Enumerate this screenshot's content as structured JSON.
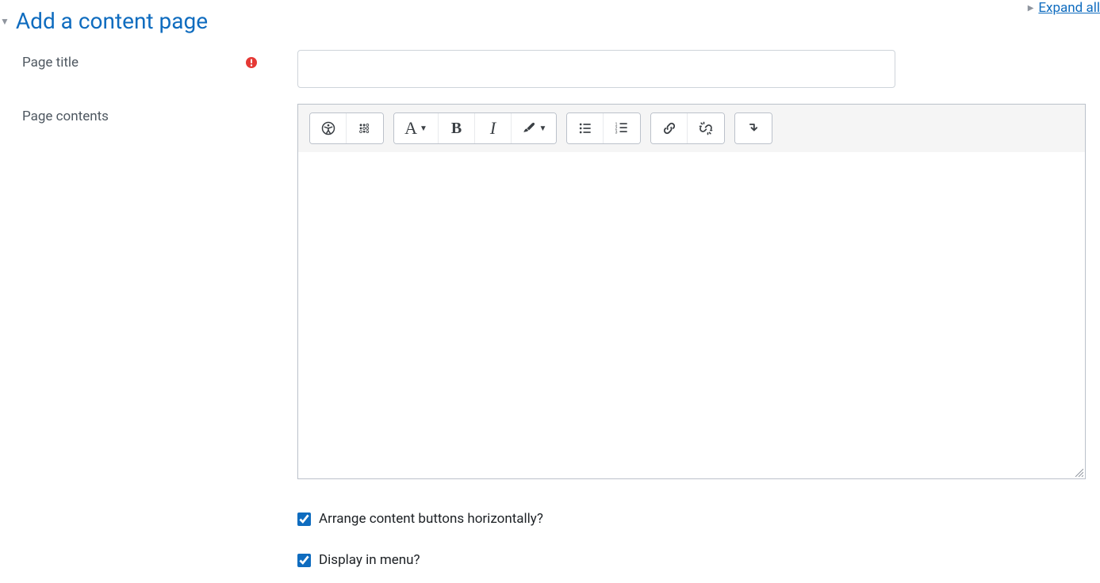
{
  "expandAll": "Expand all",
  "section": {
    "title": "Add a content page"
  },
  "fields": {
    "pageTitle": {
      "label": "Page title",
      "value": "",
      "required": true
    },
    "pageContents": {
      "label": "Page contents",
      "value": ""
    }
  },
  "editor": {
    "buttons": {
      "accessibility": "Accessibility checker",
      "screenreader": "Screenreader helper",
      "styles": "Paragraph styles",
      "bold": "Bold",
      "italic": "Italic",
      "formatting": "Text formatting",
      "ul": "Unordered list",
      "ol": "Ordered list",
      "link": "Link",
      "unlink": "Unlink",
      "expand": "Show more buttons"
    }
  },
  "checkboxes": {
    "arrange": {
      "label": "Arrange content buttons horizontally?",
      "checked": true
    },
    "display": {
      "label": "Display in menu?",
      "checked": true
    }
  }
}
